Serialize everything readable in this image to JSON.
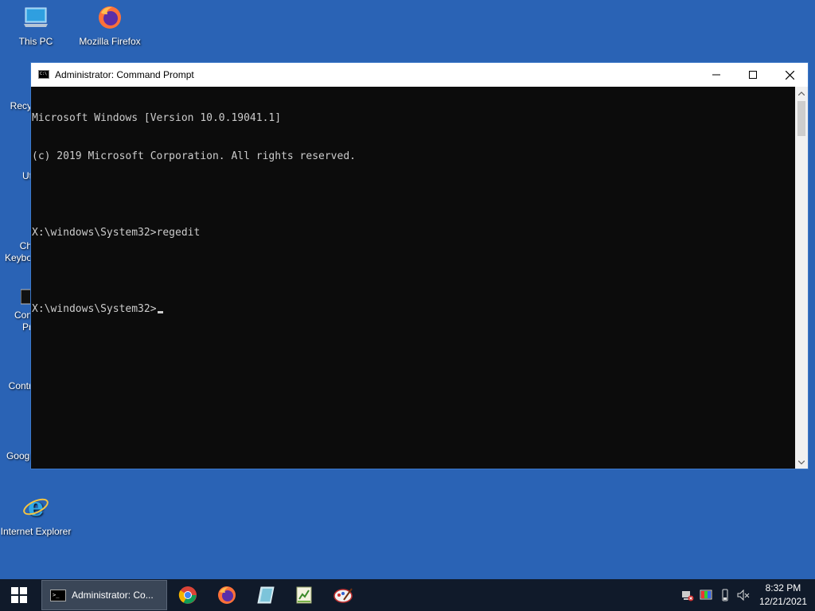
{
  "desktop": {
    "icons": [
      {
        "label": "This PC",
        "icon": "this-pc-icon"
      },
      {
        "label": "Mozilla Firefox",
        "icon": "firefox-icon"
      },
      {
        "label": "Recy",
        "icon": "recycle-bin-icon"
      },
      {
        "label": "Ut",
        "icon": "utilities-icon"
      },
      {
        "label": "Ch",
        "label2": "Keybo",
        "icon": "keyboard-icon"
      },
      {
        "label": "Con",
        "label2": "Pr",
        "icon": "command-prompt-icon"
      },
      {
        "label": "Contr",
        "icon": "control-panel-icon"
      },
      {
        "label": "Googl",
        "icon": "chrome-icon"
      },
      {
        "label": "Internet Explorer",
        "icon": "internet-explorer-icon"
      }
    ]
  },
  "window": {
    "title": "Administrator: Command Prompt",
    "console_lines": [
      "Microsoft Windows [Version 10.0.19041.1]",
      "(c) 2019 Microsoft Corporation. All rights reserved.",
      "",
      "X:\\windows\\System32>regedit",
      "",
      "X:\\windows\\System32>"
    ]
  },
  "taskbar": {
    "active_task_label": "Administrator: Co...",
    "pinned": [
      "chrome-icon",
      "firefox-icon",
      "notepad-icon",
      "spreadsheet-icon",
      "paint-icon"
    ],
    "tray_icons": [
      "network-error-icon",
      "color-icon",
      "usb-icon",
      "volume-muted-icon"
    ],
    "clock_time": "8:32 PM",
    "clock_date": "12/21/2021"
  },
  "colors": {
    "desktop_bg": "#2a63b5",
    "taskbar_bg": "#101a2a",
    "console_bg": "#0c0c0c",
    "console_fg": "#cccccc"
  }
}
